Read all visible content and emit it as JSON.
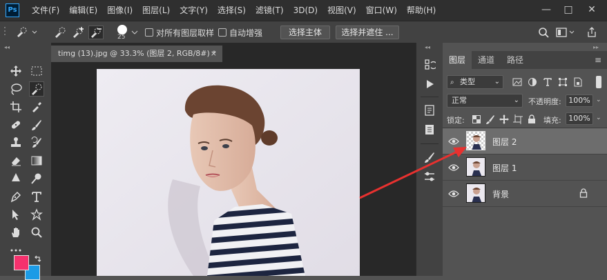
{
  "app": {
    "logo": "Ps"
  },
  "menubar": {
    "items": [
      "文件(F)",
      "编辑(E)",
      "图像(I)",
      "图层(L)",
      "文字(Y)",
      "选择(S)",
      "滤镜(T)",
      "3D(D)",
      "视图(V)",
      "窗口(W)",
      "帮助(H)"
    ],
    "minimize": "—",
    "maximize": "□",
    "close": "✕"
  },
  "options": {
    "brush_size": "25",
    "sample_all_layers": "对所有图层取样",
    "auto_enhance": "自动增强",
    "select_subject": "选择主体",
    "select_and_mask": "选择并遮住 ..."
  },
  "document": {
    "tab_title": "timg (13).jpg @ 33.3% (图层 2, RGB/8#) *",
    "close": "×"
  },
  "colors": {
    "foreground": "#f5316d",
    "background": "#1c9be6",
    "arrow": "#e8312f"
  },
  "panels": {
    "tabs": [
      "图层",
      "通道",
      "路径"
    ],
    "filter_kind": "类型",
    "blend_mode": "正常",
    "opacity_label": "不透明度:",
    "opacity_value": "100%",
    "lock_label": "锁定:",
    "fill_label": "填充:",
    "fill_value": "100%",
    "layers": [
      {
        "name": "图层 2",
        "selected": true
      },
      {
        "name": "图层 1",
        "selected": false
      },
      {
        "name": "背景",
        "selected": false,
        "locked": true
      }
    ]
  }
}
